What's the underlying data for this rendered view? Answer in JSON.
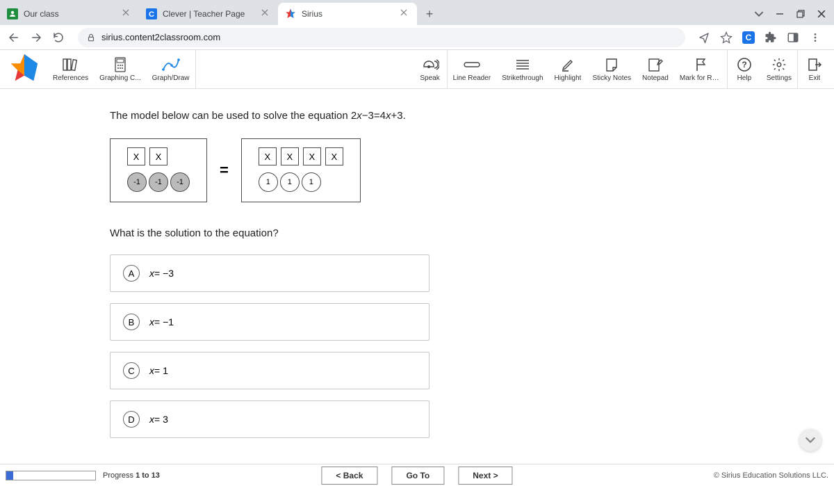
{
  "browser": {
    "tabs": [
      {
        "title": "Our class"
      },
      {
        "title": "Clever | Teacher Page"
      },
      {
        "title": "Sirius"
      }
    ],
    "url": "sirius.content2classroom.com"
  },
  "toolbar": {
    "references": "References",
    "graphing": "Graphing C...",
    "graphdraw": "Graph/Draw",
    "speak": "Speak",
    "linereader": "Line Reader",
    "strike": "Strikethrough",
    "highlight": "Highlight",
    "sticky": "Sticky Notes",
    "notepad": "Notepad",
    "mark": "Mark for Re...",
    "help": "Help",
    "settings": "Settings",
    "exit": "Exit"
  },
  "question": {
    "prompt_before": "The model below can be used to solve the equation 2",
    "prompt_mid1": "−3=4",
    "prompt_after": "+3.",
    "x": "x",
    "tile_x": "X",
    "neg1": "-1",
    "pos1": "1",
    "eq": "=",
    "sub": "What is the solution to the equation?",
    "answers": [
      {
        "letter": "A",
        "text": "= −3"
      },
      {
        "letter": "B",
        "text": "= −1"
      },
      {
        "letter": "C",
        "text": "= 1"
      },
      {
        "letter": "D",
        "text": "= 3"
      }
    ]
  },
  "bottom": {
    "progress_label": "Progress ",
    "progress_bold": "1 to 13",
    "progress_pct": 7.7,
    "back": "< Back",
    "goto": "Go To",
    "next": "Next >",
    "copyright": "© Sirius Education Solutions LLC."
  }
}
